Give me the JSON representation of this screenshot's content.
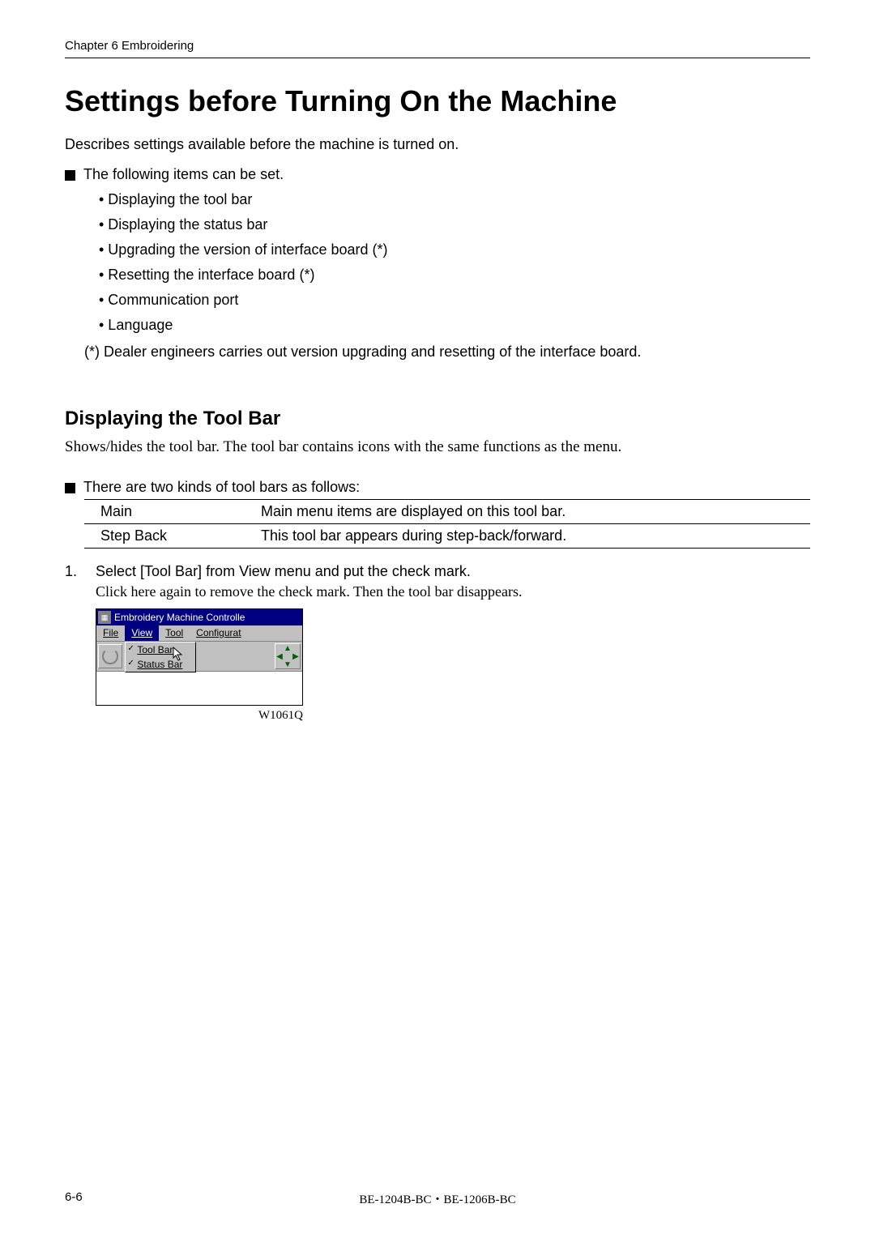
{
  "header": {
    "chapter": "Chapter 6    Embroidering"
  },
  "title": "Settings before Turning On the Machine",
  "intro": "Describes settings available before the machine is turned on.",
  "can_be_set_heading": "The following items can be set.",
  "bullets": [
    "• Displaying the tool bar",
    "• Displaying the status bar",
    "• Upgrading the version of interface board (*)",
    "• Resetting the interface board (*)",
    "• Communication port",
    "• Language"
  ],
  "note": "(*) Dealer engineers carries out version upgrading and resetting of the interface board.",
  "section": {
    "heading": "Displaying the Tool Bar",
    "desc": "Shows/hides the tool bar.    The tool bar contains icons with the same functions as the menu."
  },
  "table_intro": "There are two kinds of tool bars as follows:",
  "table": {
    "rows": [
      {
        "c1": "Main",
        "c2": "Main menu items are displayed on this tool bar."
      },
      {
        "c1": "Step Back",
        "c2": "This tool bar appears during step-back/forward."
      }
    ]
  },
  "step": {
    "num": "1.",
    "text": "Select [Tool Bar] from View menu and put the check mark.",
    "sub": "Click here again to remove the check mark.    Then the tool bar disappears."
  },
  "screenshot": {
    "window_title": "Embroidery Machine Controlle",
    "menu": {
      "file": "File",
      "view": "View",
      "tool": "Tool",
      "configurat": "Configurat"
    },
    "dropdown": {
      "toolbar": "Tool Bar",
      "statusbar": "Status Bar"
    },
    "label": "W1061Q"
  },
  "footer": {
    "page": "6-6",
    "models": "BE-1204B-BC・BE-1206B-BC"
  }
}
